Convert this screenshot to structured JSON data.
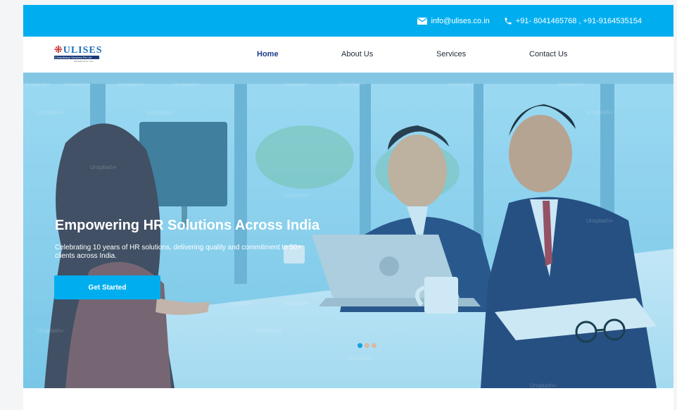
{
  "topbar": {
    "email": "info@ulises.co.in",
    "phone": "+91- 8041465768 , +91-9164535154",
    "email_icon": "mail-icon",
    "phone_icon": "phone-icon"
  },
  "logo": {
    "brand": "ULISES",
    "company": "Consultancy Services Pvt Ltd",
    "tagline": "WE ARE WITH YOU"
  },
  "nav": {
    "home": "Home",
    "about": "About Us",
    "services": "Services",
    "contact": "Contact Us"
  },
  "hero": {
    "title": "Empowering HR Solutions Across India",
    "subtitle": "Celebrating 10 years of HR solutions, delivering quality and commitment to 50+ clients across India.",
    "cta_label": "Get Started",
    "slides_total": 3,
    "active_slide": 1,
    "watermark": "Unsplash+"
  },
  "colors": {
    "accent": "#00aeef",
    "nav_active": "#1e3a8a"
  }
}
